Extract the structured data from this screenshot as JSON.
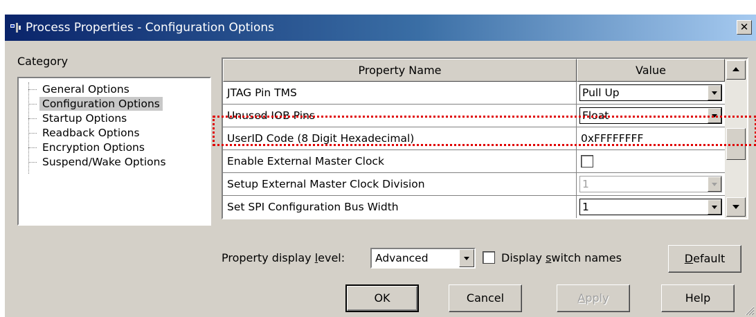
{
  "window": {
    "title": "Process Properties - Configuration Options",
    "close_glyph": "✕"
  },
  "category": {
    "label": "Category",
    "items": [
      {
        "label": "General Options",
        "selected": false
      },
      {
        "label": "Configuration Options",
        "selected": true
      },
      {
        "label": "Startup Options",
        "selected": false
      },
      {
        "label": "Readback Options",
        "selected": false
      },
      {
        "label": "Encryption Options",
        "selected": false
      },
      {
        "label": "Suspend/Wake Options",
        "selected": false
      }
    ]
  },
  "grid": {
    "columns": {
      "name": "Property Name",
      "value": "Value"
    },
    "rows": [
      {
        "name": "JTAG Pin TMS",
        "value": "Pull Up",
        "kind": "combo"
      },
      {
        "name": "Unused IOB Pins",
        "value": "Float",
        "kind": "combo"
      },
      {
        "name": "UserID Code (8 Digit Hexadecimal)",
        "value": "0xFFFFFFFF",
        "kind": "text"
      },
      {
        "name": "Enable External Master Clock",
        "value": "",
        "kind": "checkbox"
      },
      {
        "name": "Setup External Master Clock Division",
        "value": "1",
        "kind": "combo-disabled"
      },
      {
        "name": "Set SPI Configuration Bus Width",
        "value": "1",
        "kind": "combo"
      }
    ]
  },
  "footer": {
    "level_label_pre": "Property display ",
    "level_label_key": "l",
    "level_label_post": "evel:",
    "level_value": "Advanced",
    "switch_label_pre": "Display ",
    "switch_label_key": "s",
    "switch_label_post": "witch names",
    "default_key": "D",
    "default_rest": "efault"
  },
  "buttons": {
    "ok": "OK",
    "cancel": "Cancel",
    "apply_key": "A",
    "apply_rest": "pply",
    "help": "Help"
  },
  "colors": {
    "title_start": "#0a246a",
    "title_end": "#a6caf0",
    "face": "#d4d0c8",
    "highlight": "#e00000"
  }
}
